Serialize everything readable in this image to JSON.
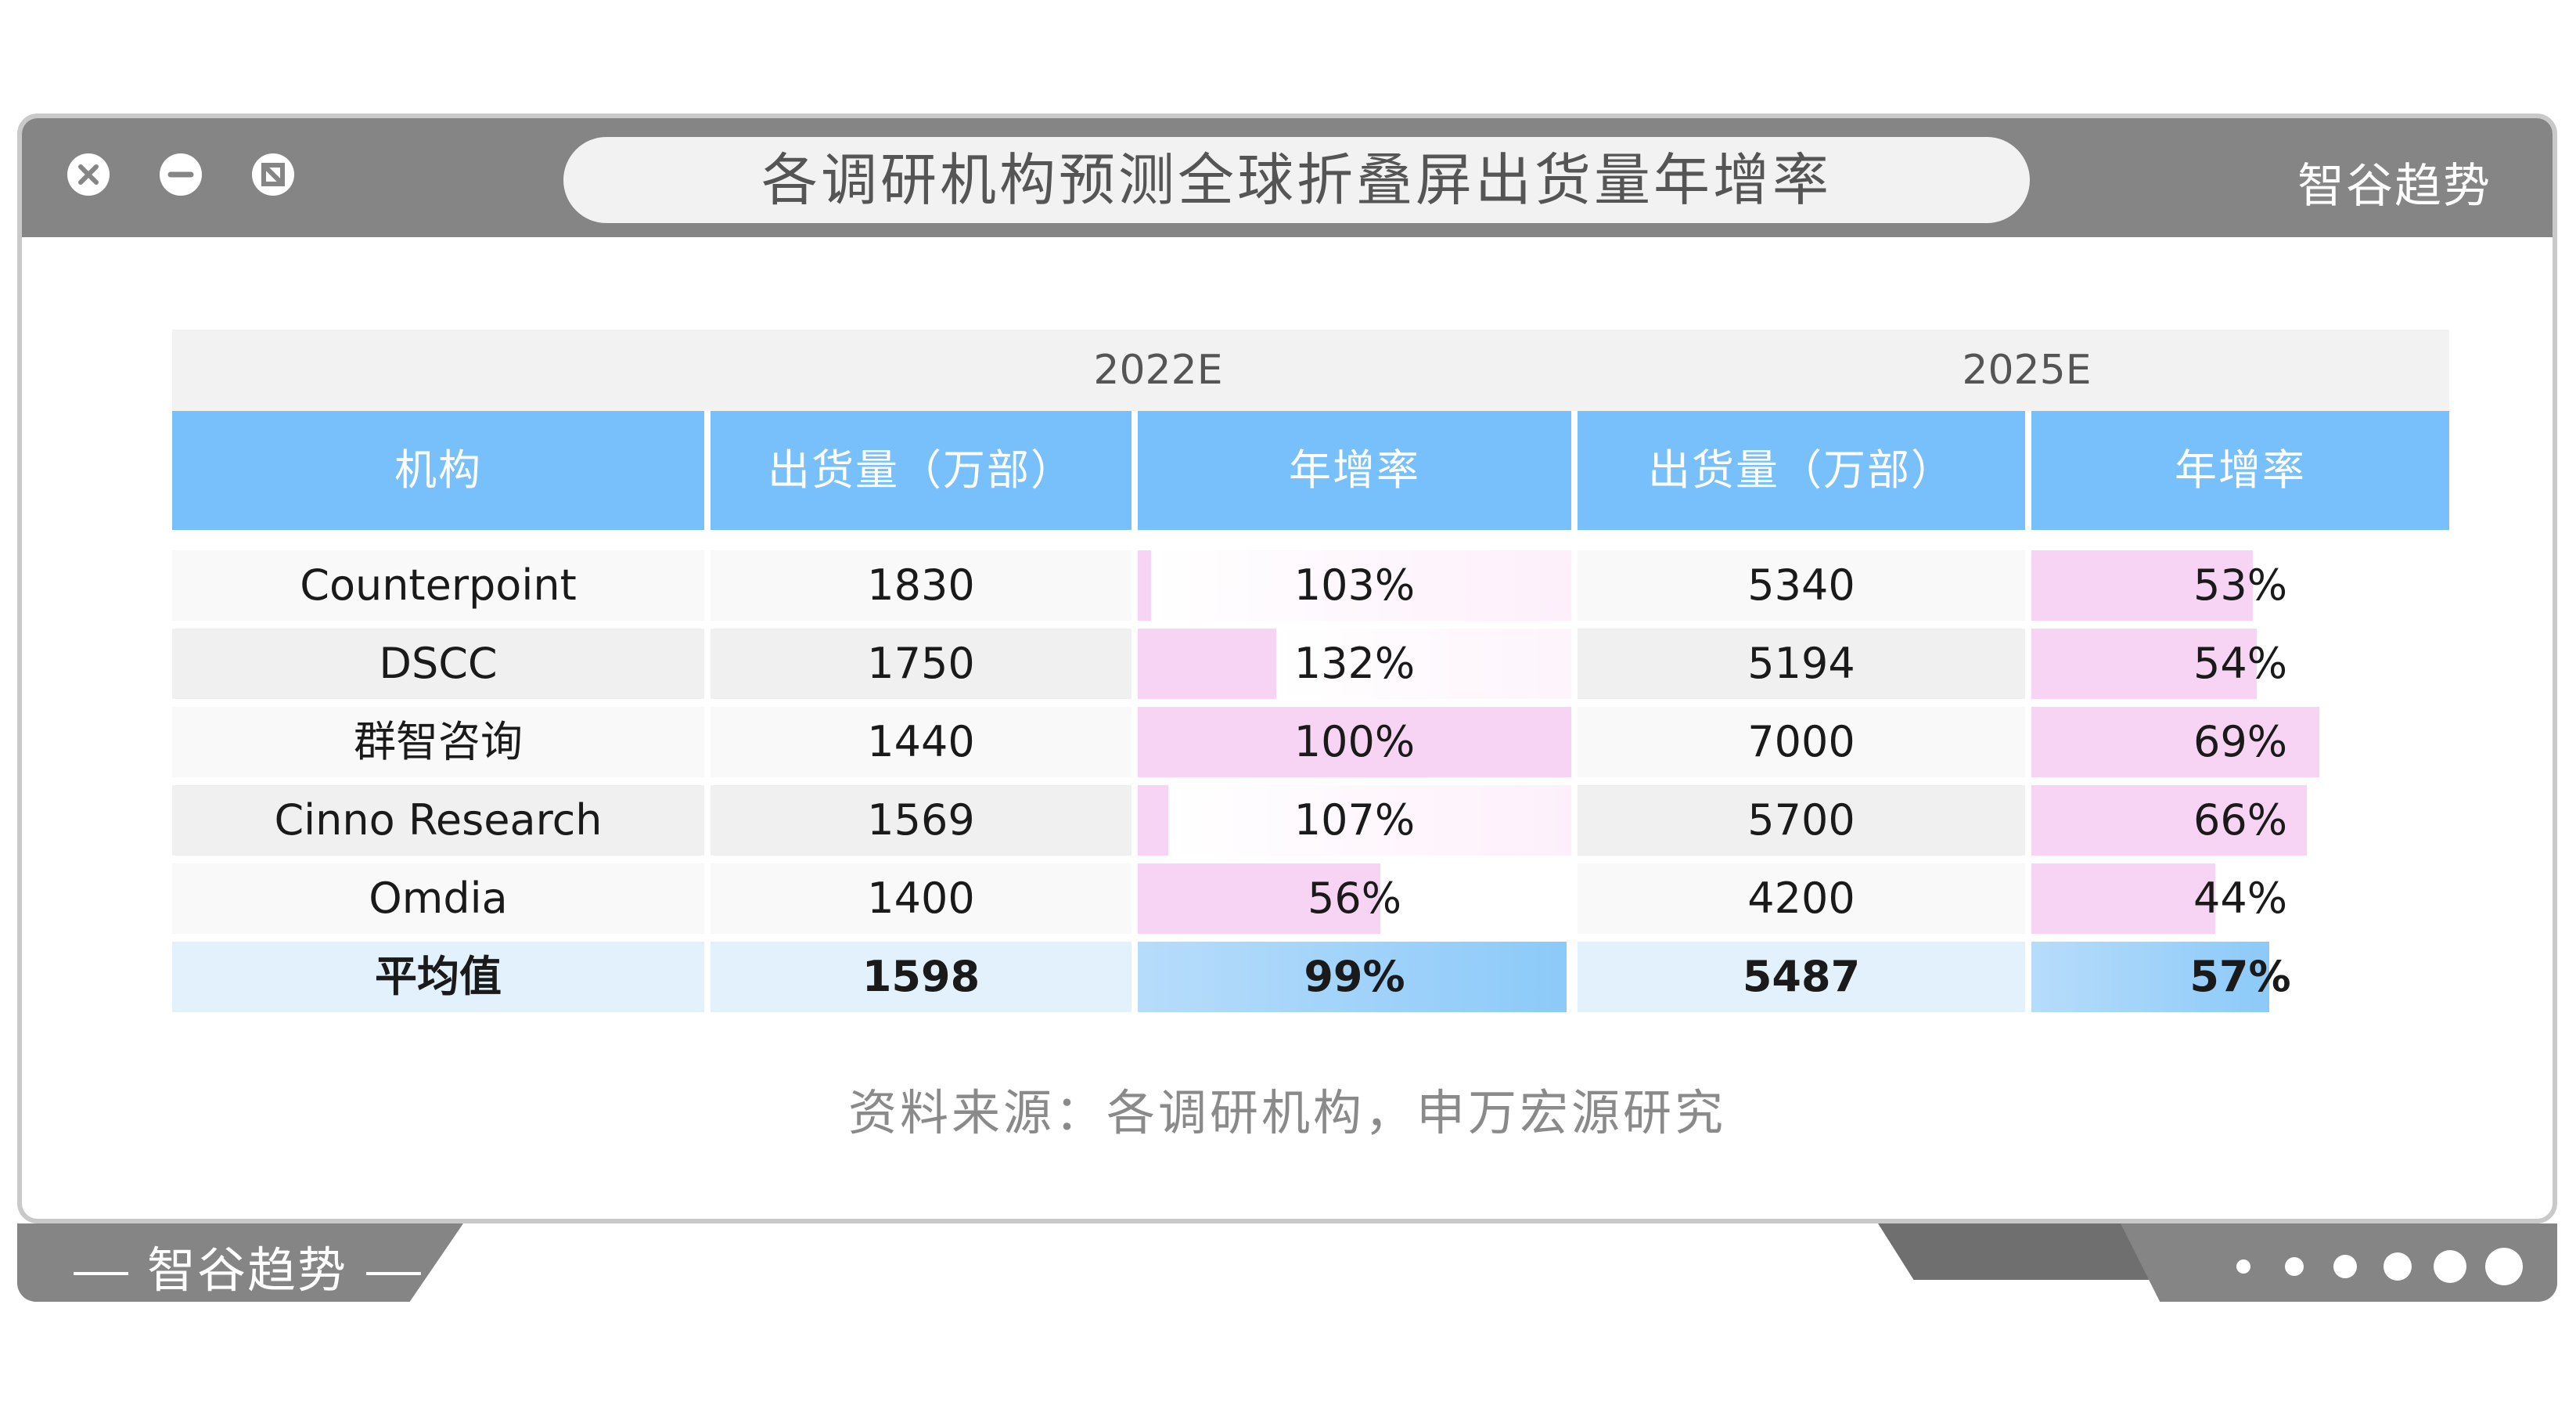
{
  "window": {
    "title": "各调研机构预测全球折叠屏出货量年增率",
    "brand": "智谷趋势"
  },
  "table": {
    "group_headers": [
      "2022E",
      "2025E"
    ],
    "columns": [
      "机构",
      "出货量（万部）",
      "年增率",
      "出货量（万部）",
      "年增率"
    ],
    "rows": [
      {
        "org": "Counterpoint",
        "ship_2022": "1830",
        "growth_2022": "103%",
        "ship_2025": "5340",
        "growth_2025": "53%"
      },
      {
        "org": "DSCC",
        "ship_2022": "1750",
        "growth_2022": "132%",
        "ship_2025": "5194",
        "growth_2025": "54%"
      },
      {
        "org": "群智咨询",
        "ship_2022": "1440",
        "growth_2022": "100%",
        "ship_2025": "7000",
        "growth_2025": "69%"
      },
      {
        "org": "Cinno Research",
        "ship_2022": "1569",
        "growth_2022": "107%",
        "ship_2025": "5700",
        "growth_2025": "66%"
      },
      {
        "org": "Omdia",
        "ship_2022": "1400",
        "growth_2022": "56%",
        "ship_2025": "4200",
        "growth_2025": "44%"
      }
    ],
    "average": {
      "org": "平均值",
      "ship_2022": "1598",
      "growth_2022": "99%",
      "ship_2025": "5487",
      "growth_2025": "57%"
    }
  },
  "source": "资料来源：各调研机构，申万宏源研究",
  "footer": {
    "brand": "智谷趋势"
  },
  "colors": {
    "header_blue": "#77c0fb",
    "bar_pink": "#f8d4f4",
    "avg_bar_blue": "#8ccaf9",
    "frame_gray": "#858585"
  }
}
